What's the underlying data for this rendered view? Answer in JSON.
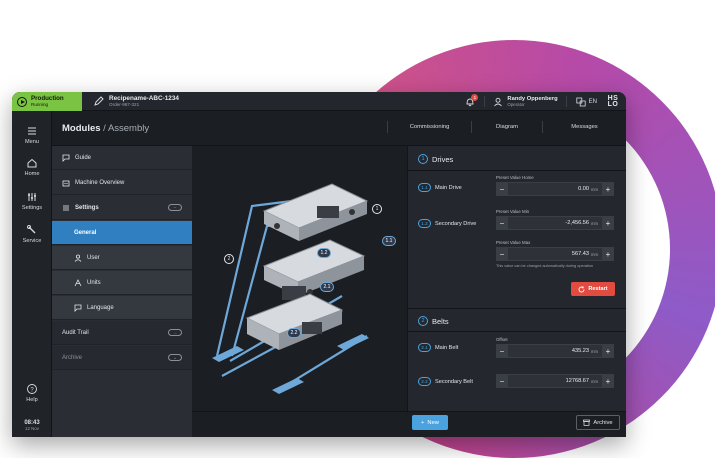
{
  "status": {
    "label": "Production",
    "state": "Running",
    "color": "#7bc342"
  },
  "recipe": {
    "name": "Recipename-ABC-1234",
    "order": "Order-987-321"
  },
  "notifications": {
    "count": "1"
  },
  "user": {
    "name": "Randy Oppenberg",
    "role": "Operator"
  },
  "language": "EN",
  "logo": {
    "line1": "HS",
    "line2": "LO"
  },
  "rail": {
    "menu": "Menu",
    "home": "Home",
    "settings": "Settings",
    "service": "Service",
    "help": "Help",
    "time": "08:43",
    "date": "12 Nov"
  },
  "header": {
    "title": "Modules",
    "separator": " / ",
    "subtitle": "Assembly",
    "tabs": [
      "Commissioning",
      "Diagram",
      "Messages"
    ]
  },
  "nav": {
    "guide": "Guide",
    "machine_overview": "Machine Overview",
    "settings": "Settings",
    "general": "General",
    "user": "User",
    "units": "Units",
    "language": "Language",
    "audit_trail": "Audit Trail",
    "archive": "Archive"
  },
  "diagram": {
    "labels": [
      "1",
      "1.1",
      "1.2",
      "2",
      "2.1",
      "2.2"
    ]
  },
  "drives": {
    "number": "1",
    "title": "Drives",
    "main": {
      "num": "1.1",
      "label": "Main Drive",
      "preset_label": "Preset Value Home",
      "value": "0.00",
      "unit": "mm"
    },
    "secondary": {
      "num": "1.2",
      "label": "Secondary Drive",
      "min_label": "Preset Value Min",
      "min_value": "-2,456.56",
      "min_unit": "mm",
      "max_label": "Preset Value Max",
      "max_value": "567.43",
      "max_unit": "mm",
      "hint": "This value can be changed automatically during operation"
    },
    "restart": "Restart"
  },
  "belts": {
    "number": "2",
    "title": "Belts",
    "main": {
      "num": "2.1",
      "label": "Main Belt",
      "offset_label": "Offset",
      "value": "435.23",
      "unit": "mm"
    },
    "secondary": {
      "num": "2.2",
      "label": "Secondary Belt",
      "value": "12768.67",
      "unit": "mm"
    }
  },
  "footer": {
    "new": "New",
    "archive": "Archive"
  },
  "colors": {
    "accent": "#2f7fc1",
    "link": "#4aa3df",
    "danger": "#e24b3f"
  }
}
